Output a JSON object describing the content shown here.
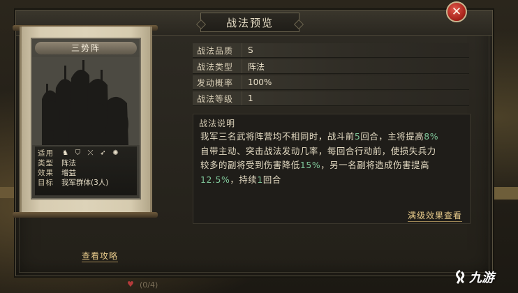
{
  "dialog": {
    "title": "战法预览",
    "close_label": "✕"
  },
  "card": {
    "name": "三势阵",
    "info": [
      {
        "key": "适用",
        "value": ""
      },
      {
        "key": "类型",
        "value": "阵法"
      },
      {
        "key": "效果",
        "value": "增益"
      },
      {
        "key": "目标",
        "value": "我军群体(3人)"
      }
    ],
    "troop_icons": [
      "cavalry-icon",
      "shield-icon",
      "bow-icon",
      "spear-icon",
      "siege-icon"
    ]
  },
  "fields": [
    {
      "key": "战法品质",
      "value": "S"
    },
    {
      "key": "战法类型",
      "value": "阵法"
    },
    {
      "key": "发动概率",
      "value": "100%"
    },
    {
      "key": "战法等级",
      "value": "1"
    }
  ],
  "description": {
    "title": "战法说明",
    "line1_a": "我军三名武将阵营均不相同时，战斗前",
    "line1_b": "5",
    "line1_c": "回合，主将提高",
    "line1_d": "8%",
    "line2": "自带主动、突击战法发动几率，每回合行动前，使损失兵力",
    "line3_a": "较多的副将受到伤害降低",
    "line3_b": "15%",
    "line3_c": "，另一名副将造成伤害提高",
    "line4_a": "12.5%",
    "line4_b": "，持续",
    "line4_c": "1",
    "line4_d": "回合"
  },
  "links": {
    "full_effect": "满级效果查看",
    "guide": "查看攻略"
  },
  "scene": {
    "bottom_text": "(0/4)"
  },
  "watermark": {
    "text": "九游"
  },
  "colors": {
    "highlight": "#7fc79a",
    "link": "#e6c98a",
    "close": "#a8231b"
  }
}
